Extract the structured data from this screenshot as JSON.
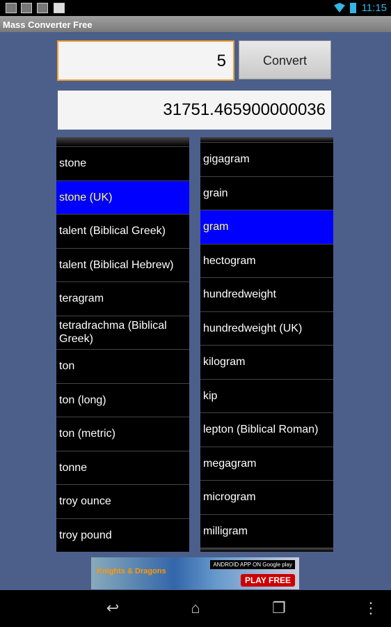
{
  "status_bar": {
    "time": "11:15",
    "notification_icons": [
      "gallery-icon",
      "basic-android-icon",
      "app-icon",
      "checkbox-bag-icon"
    ]
  },
  "app": {
    "title": "Mass Converter Free"
  },
  "converter": {
    "input_value": "5",
    "convert_label": "Convert",
    "result": "31751.465900000036"
  },
  "from_list": {
    "selected": "stone (UK)",
    "items": [
      "stone",
      "stone (UK)",
      "talent (Biblical Greek)",
      "talent (Biblical Hebrew)",
      "teragram",
      "tetradrachma (Biblical Greek)",
      "ton",
      "ton (long)",
      "ton (metric)",
      "tonne",
      "troy ounce",
      "troy pound"
    ]
  },
  "to_list": {
    "selected": "gram",
    "items": [
      "gigagram",
      "grain",
      "gram",
      "hectogram",
      "hundredweight",
      "hundredweight (UK)",
      "kilogram",
      "kip",
      "lepton (Biblical Roman)",
      "megagram",
      "microgram",
      "milligram"
    ]
  },
  "ad": {
    "brand": "Knights & Dragons",
    "store": "ANDROID APP ON Google play",
    "cta": "PLAY FREE"
  },
  "colors": {
    "background": "#4b5f8a",
    "selected": "#0000ff",
    "selected_text": "#ffff66",
    "input_focus": "#f0a030"
  }
}
